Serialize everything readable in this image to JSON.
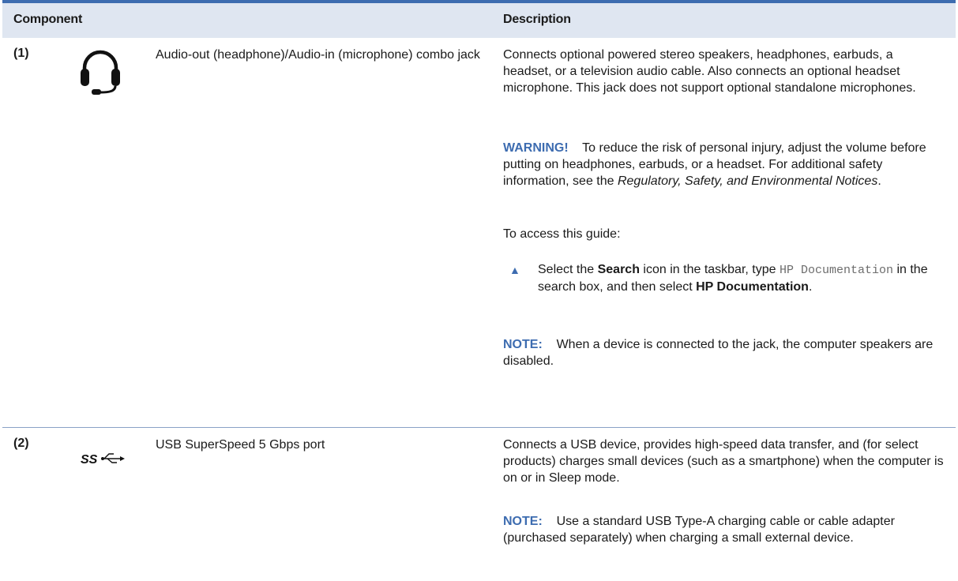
{
  "header": {
    "component": "Component",
    "description": "Description"
  },
  "rows": [
    {
      "number": "(1)",
      "icon": "headphone-icon",
      "component": "Audio-out (headphone)/Audio-in (microphone) combo jack",
      "description": "Connects optional powered stereo speakers, headphones, earbuds, a headset, or a television audio cable. Also connects an optional headset microphone. This jack does not support optional standalone microphones.",
      "warning": {
        "label": "WARNING!",
        "text": "To reduce the risk of personal injury, adjust the volume before putting on headphones, earbuds, or a headset. For additional safety information, see the ",
        "doc_title": "Regulatory, Safety, and Environmental Notices",
        "end": "."
      },
      "access_text": "To access this guide:",
      "step": {
        "bullet": "▲",
        "t1": "Select the ",
        "b1": "Search",
        "t2": " icon in the taskbar, type ",
        "code": "HP Documentation",
        "t3": " in the search box, and then select ",
        "b2": "HP Documentation",
        "t4": "."
      },
      "note": {
        "label": "NOTE:",
        "text": "When a device is connected to the jack, the computer speakers are disabled."
      }
    },
    {
      "number": "(2)",
      "icon": "usb-superspeed-icon",
      "icon_text": "SS",
      "component": "USB SuperSpeed 5 Gbps port",
      "description": "Connects a USB device, provides high-speed data transfer, and (for select products) charges small devices (such as a smartphone) when the computer is on or in Sleep mode.",
      "note": {
        "label": "NOTE:",
        "text": "Use a standard USB Type-A charging cable or cable adapter (purchased separately) when charging a small external device."
      }
    }
  ],
  "colors": {
    "accent": "#3d6cb0",
    "header_bg": "#dfe6f1",
    "rule": "#8aa1c6"
  }
}
